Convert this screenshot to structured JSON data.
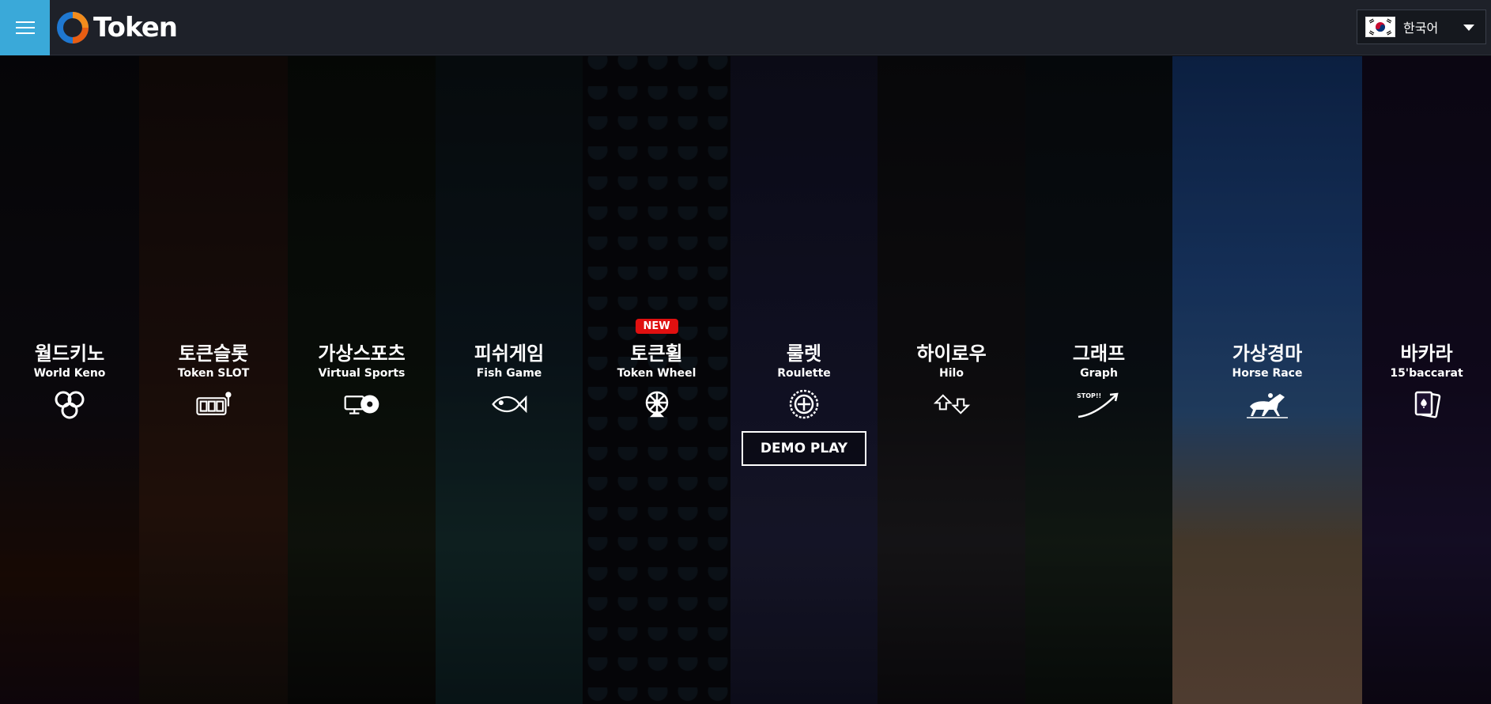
{
  "header": {
    "logo_text": "Token",
    "language": {
      "label": "한국어",
      "flag_icon": "korea-flag-icon"
    },
    "menu_icon": "hamburger-menu-icon"
  },
  "games": [
    {
      "kr": "월드키노",
      "en": "World Keno",
      "icon": "keno-balls-icon"
    },
    {
      "kr": "토큰슬롯",
      "en": "Token SLOT",
      "icon": "slot-machine-icon"
    },
    {
      "kr": "가상스포츠",
      "en": "Virtual Sports",
      "icon": "sports-ball-screen-icon"
    },
    {
      "kr": "피쉬게임",
      "en": "Fish Game",
      "icon": "fish-icon"
    },
    {
      "kr": "토큰휠",
      "en": "Token Wheel",
      "icon": "wheel-icon",
      "badge": "NEW"
    },
    {
      "kr": "룰렛",
      "en": "Roulette",
      "icon": "roulette-icon",
      "button": "DEMO PLAY"
    },
    {
      "kr": "하이로우",
      "en": "Hilo",
      "icon": "up-down-arrows-icon"
    },
    {
      "kr": "그래프",
      "en": "Graph",
      "icon": "graph-arrow-icon",
      "icon_text": "STOP!!"
    },
    {
      "kr": "가상경마",
      "en": "Horse Race",
      "icon": "horse-race-icon"
    },
    {
      "kr": "바카라",
      "en": "15'baccarat",
      "icon": "cards-icon"
    }
  ],
  "colors": {
    "accent": "#3aa9d9",
    "badge": "#e01010",
    "topbar": "#1e2129"
  }
}
